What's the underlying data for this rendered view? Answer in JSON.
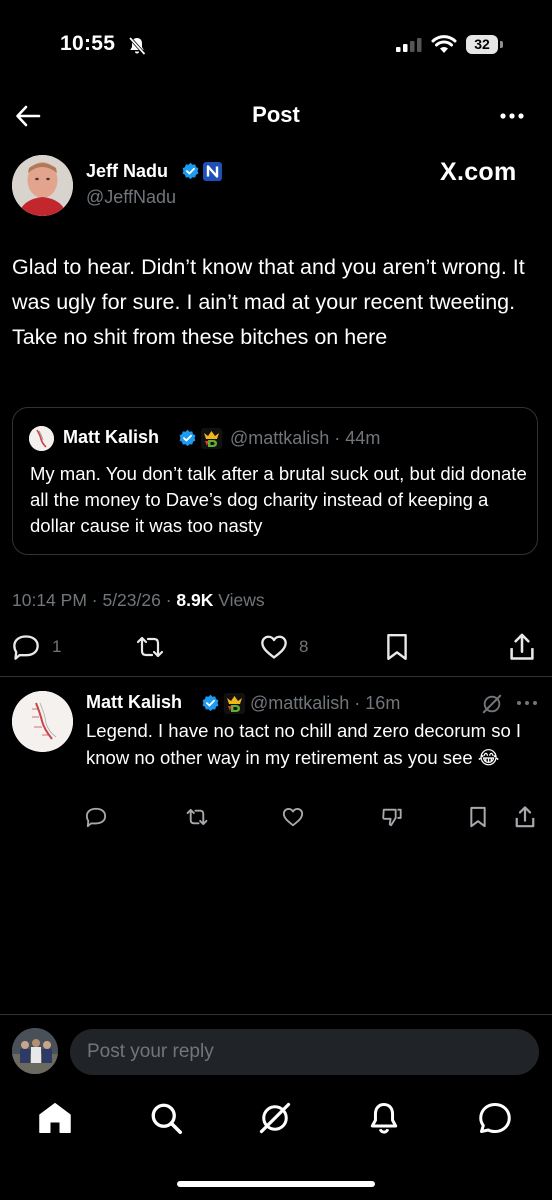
{
  "status_bar": {
    "time": "10:55",
    "battery": "32"
  },
  "header": {
    "title": "Post"
  },
  "post": {
    "author_name": "Jeff Nadu",
    "author_handle": "@JeffNadu",
    "source_label": "X.com",
    "text": "Glad to hear. Didn’t know that and you aren’t wrong. It was ugly for sure. I ain’t mad at your recent tweeting. Take no shit from these bitches on here",
    "quoted": {
      "author_name": "Matt Kalish",
      "handle_and_time": "@mattkalish · 44m",
      "text": "My man.  You don’t talk after a brutal suck out, but did donate all the money to Dave’s dog charity instead of keeping a dollar cause it was too nasty"
    },
    "timestamp": "10:14 PM · 5/23/26 · ",
    "views_count": "8.9K",
    "views_label": " Views",
    "actions": {
      "replies": "1",
      "likes": "8"
    }
  },
  "reply": {
    "author_name": "Matt Kalish",
    "handle_and_time": "@mattkalish · 16m",
    "text": "Legend.  I have no tact no chill and zero decorum so I know no other way in my retirement as you see 😂"
  },
  "compose": {
    "placeholder": "Post your reply"
  },
  "colors": {
    "background": "#000000",
    "accent": "#1d9bf0",
    "muted": "#71767b"
  }
}
